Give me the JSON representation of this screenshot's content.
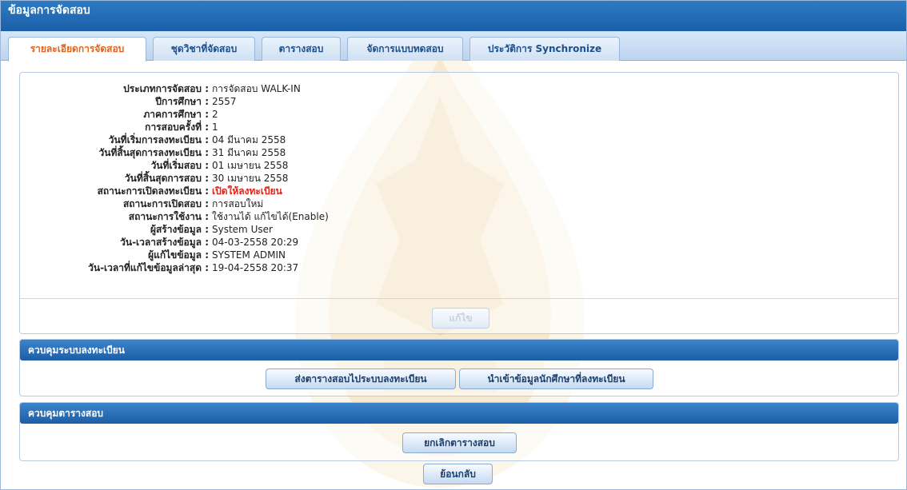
{
  "window": {
    "title": "ข้อมูลการจัดสอบ"
  },
  "tabs": [
    {
      "label": "รายละเอียดการจัดสอบ",
      "active": true
    },
    {
      "label": "ชุดวิชาที่จัดสอบ",
      "active": false
    },
    {
      "label": "ตารางสอบ",
      "active": false
    },
    {
      "label": "จัดการแบบทดสอบ",
      "active": false
    },
    {
      "label": "ประวัติการ Synchronize",
      "active": false
    }
  ],
  "details": [
    {
      "label": "ประเภทการจัดสอบ :",
      "value": "การจัดสอบ WALK-IN"
    },
    {
      "label": "ปีการศึกษา :",
      "value": "2557"
    },
    {
      "label": "ภาคการศึกษา :",
      "value": "2"
    },
    {
      "label": "การสอบครั้งที่ :",
      "value": "1"
    },
    {
      "label": "วันที่เริ่มการลงทะเบียน :",
      "value": "04 มีนาคม 2558"
    },
    {
      "label": "วันที่สิ้นสุดการลงทะเบียน :",
      "value": "31 มีนาคม 2558"
    },
    {
      "label": "วันที่เริ่มสอบ :",
      "value": "01 เมษายน 2558"
    },
    {
      "label": "วันที่สิ้นสุดการสอบ :",
      "value": "30 เมษายน 2558"
    },
    {
      "label": "สถานะการเปิดลงทะเบียน :",
      "value": "เปิดให้ลงทะเบียน"
    },
    {
      "label": "สถานะการเปิดสอบ :",
      "value": "การสอบใหม่"
    },
    {
      "label": "สถานะการใช้งาน :",
      "value": "ใช้งานได้ แก้ไขได้(Enable)"
    },
    {
      "label": "ผู้สร้างข้อมูล :",
      "value": "System User"
    },
    {
      "label": "วัน-เวลาสร้างข้อมูล :",
      "value": "04-03-2558 20:29"
    },
    {
      "label": "ผู้แก้ไขข้อมูล :",
      "value": "SYSTEM ADMIN"
    },
    {
      "label": "วัน-เวลาที่แก้ไขข้อมูลล่าสุด :",
      "value": "19-04-2558 20:37"
    }
  ],
  "edit_button": {
    "label": "แก้ไข",
    "disabled": true
  },
  "registration_control": {
    "title": "ควบคุมระบบลงทะเบียน",
    "send_schedule_button": "ส่งตารางสอบไประบบลงทะเบียน",
    "import_students_button": "นำเข้าข้อมูลนักศึกษาที่ลงทะเบียน"
  },
  "schedule_control": {
    "title": "ควบคุมตารางสอบ",
    "cancel_schedule_button": "ยกเลิกตารางสอบ"
  },
  "back_button": "ย้อนกลับ",
  "colors": {
    "title_bar": "#1a5fa8",
    "active_tab_text": "#e0651c",
    "tab_text": "#1d4f8c",
    "section_header": "#1d5ea5",
    "status_open_text": "#e2231a"
  }
}
